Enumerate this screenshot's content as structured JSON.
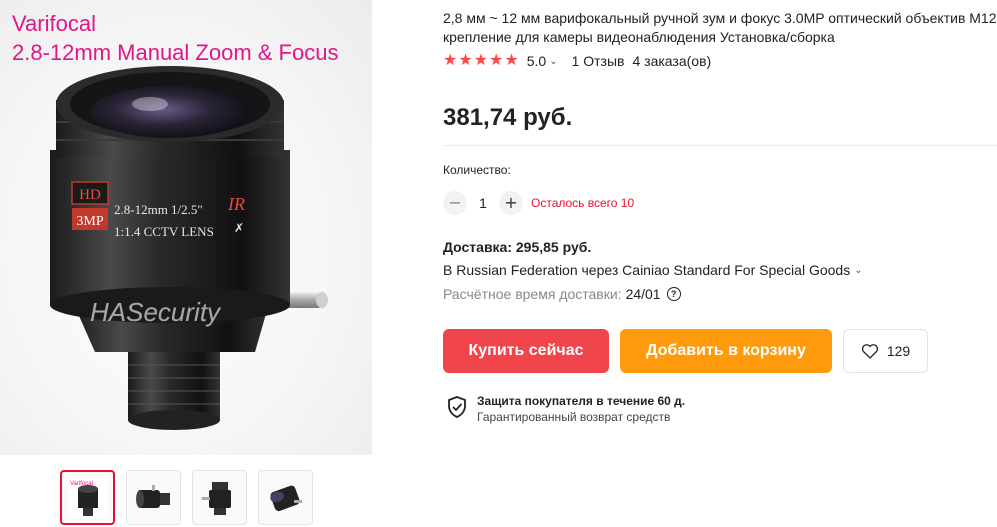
{
  "gallery": {
    "overlay_line1": "Varifocal",
    "overlay_line2": "2.8-12mm Manual Zoom & Focus",
    "lens_badge_hd": "HD",
    "lens_badge_mp": "3MP",
    "lens_text_line1": "2.8-12mm  1/2.5\"",
    "lens_text_line2": "1:1.4 CCTV LENS",
    "lens_text_ir": "IR",
    "watermark": "HASecurity",
    "thumbnails": [
      "thumbnail-1",
      "thumbnail-2",
      "thumbnail-3",
      "thumbnail-4"
    ],
    "active_thumbnail": 0
  },
  "product": {
    "title": "2,8 мм ~ 12 мм варифокальный ручной зум и фокус 3.0MP оптический объектив M12 крепление для камеры видеонаблюдения Установка/сборка",
    "rating": "5.0",
    "stars": 5,
    "reviews": "1 Отзыв",
    "orders": "4 заказа(ов)",
    "price": "381,74 руб."
  },
  "quantity": {
    "label": "Количество:",
    "value": "1",
    "stock_note": "Осталось всего 10"
  },
  "delivery": {
    "title": "Доставка: 295,85 руб.",
    "route": "В Russian Federation через Cainiao Standard For Special Goods",
    "time_label": "Расчётное время доставки:",
    "time_value": "24/01"
  },
  "actions": {
    "buy_now": "Купить сейчас",
    "add_to_cart": "Добавить в корзину",
    "wishlist_count": "129"
  },
  "protection": {
    "title": "Защита покупателя в течение 60 д.",
    "subtitle": "Гарантированный возврат средств"
  },
  "colors": {
    "accent_red": "#f0454b",
    "accent_orange": "#fe9a0c",
    "star": "#ff4747",
    "stock_red": "#e8112d",
    "overlay_pink": "#e0168a"
  }
}
